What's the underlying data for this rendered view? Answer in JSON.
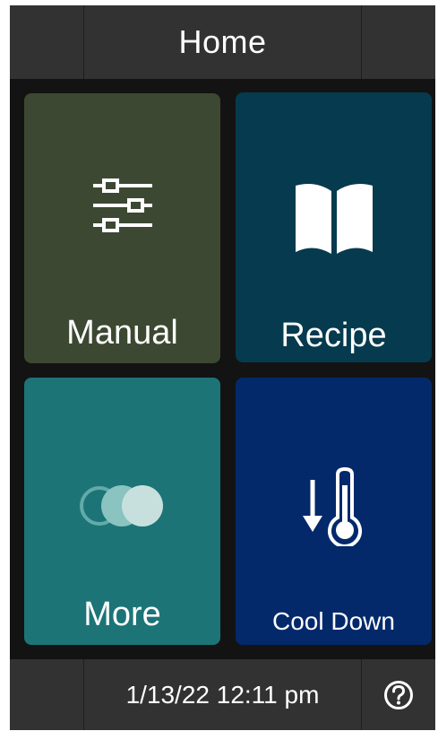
{
  "header": {
    "title": "Home"
  },
  "tiles": [
    {
      "label": "Manual",
      "icon": "sliders-icon",
      "color": "#3c4832"
    },
    {
      "label": "Recipe",
      "icon": "open-book-icon",
      "color": "#063a4e"
    },
    {
      "label": "More",
      "icon": "overlapping-circles-icon",
      "color": "#1c7477"
    },
    {
      "label": "Cool Down",
      "icon": "thermometer-down-arrow-icon",
      "color": "#03296b"
    }
  ],
  "footer": {
    "datetime": "1/13/22 12:11 pm",
    "help_icon": "help-icon"
  },
  "colors": {
    "background": "#131313",
    "bar": "#323232",
    "text": "#ffffff"
  }
}
